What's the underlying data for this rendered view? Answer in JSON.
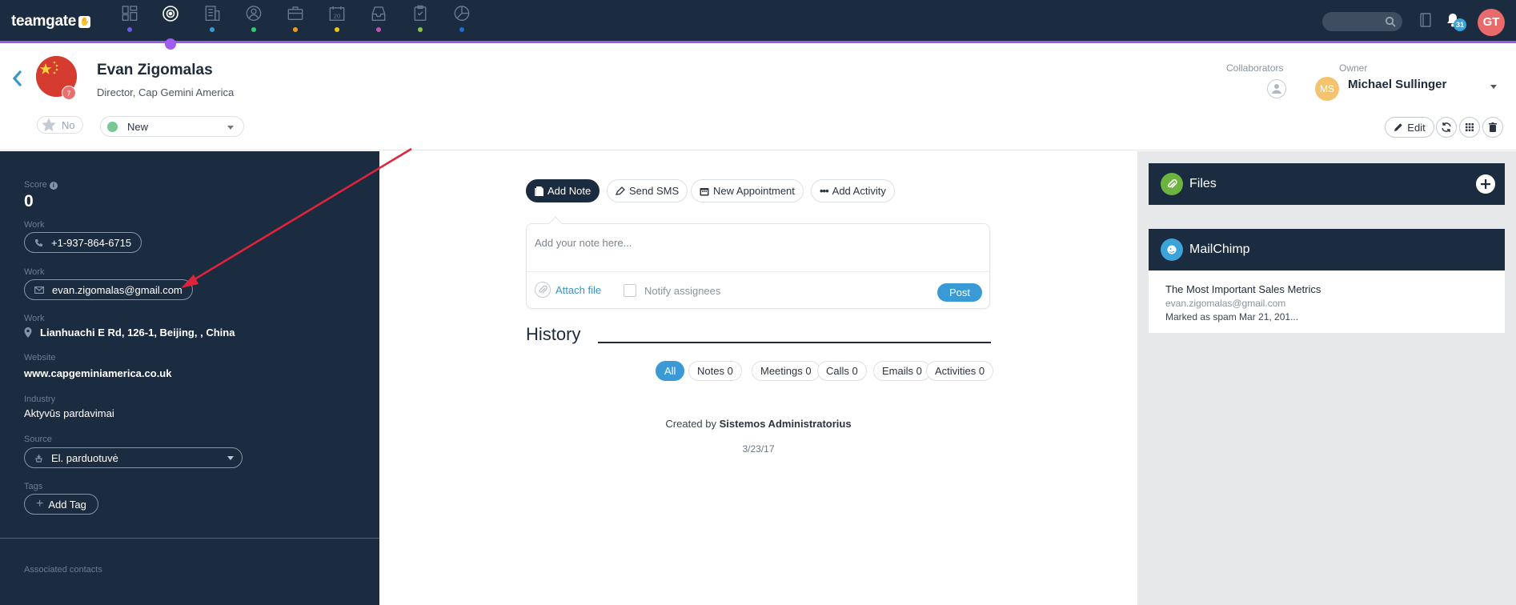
{
  "topnav": {
    "logo": "teamgate",
    "logo_badge_icon": "hand-icon",
    "icons": [
      {
        "name": "dashboard-icon",
        "dot": "#6f59e8"
      },
      {
        "name": "target-icon",
        "dot": "#a25cf2"
      },
      {
        "name": "building-icon",
        "dot": "#3a9ad5"
      },
      {
        "name": "person-icon",
        "dot": "#2ecc71"
      },
      {
        "name": "briefcase-icon",
        "dot": "#f39c12"
      },
      {
        "name": "calendar-icon",
        "dot": "#f1c40f"
      },
      {
        "name": "inbox-icon",
        "dot": "#c44fb8"
      },
      {
        "name": "clipboard-icon",
        "dot": "#8bc34a"
      },
      {
        "name": "chart-icon",
        "dot": "#1e6ed6"
      }
    ],
    "calendar_day": "20",
    "notifications_count": "31",
    "user_initials": "GT"
  },
  "header": {
    "name": "Evan Zigomalas",
    "title": "Director, Cap Gemini America",
    "avatar_count": "7",
    "collaborators_label": "Collaborators",
    "owner_label": "Owner",
    "owner_initials": "MS",
    "owner_name": "Michael Sullinger",
    "favorite_label": "No",
    "status": "New",
    "edit_label": "Edit"
  },
  "left": {
    "score_label": "Score",
    "score_value": "0",
    "phone_label": "Work",
    "phone": "+1-937-864-6715",
    "email_label": "Work",
    "email": "evan.zigomalas@gmail.com",
    "address_label": "Work",
    "address": "Lianhuachi E Rd, 126-1, Beijing, , China",
    "website_label": "Website",
    "website": "www.capgeminiamerica.co.uk",
    "industry_label": "Industry",
    "industry": "Aktyvūs pardavimai",
    "source_label": "Source",
    "source": "El. parduotuvė",
    "tags_label": "Tags",
    "add_tag": "Add Tag",
    "associated_contacts": "Associated contacts"
  },
  "center": {
    "tabs": [
      "Add Note",
      "Send SMS",
      "New Appointment",
      "Add Activity"
    ],
    "note_placeholder": "Add your note here...",
    "attach_file": "Attach file",
    "notify_assignees": "Notify assignees",
    "post": "Post",
    "history_title": "History",
    "filters": [
      "All",
      "Notes 0",
      "Meetings 0",
      "Calls 0",
      "Emails 0",
      "Activities 0"
    ],
    "created_by_prefix": "Created by",
    "created_by_name": "Sistemos Administratorius",
    "created_date": "3/23/17"
  },
  "right": {
    "files_title": "Files",
    "mailchimp_title": "MailChimp",
    "mailchimp_item_title": "The Most Important Sales Metrics",
    "mailchimp_item_email": "evan.zigomalas@gmail.com",
    "mailchimp_item_status": "Marked as spam Mar 21, 201..."
  },
  "colors": {
    "nav_bg": "#1c2c40",
    "accent_purple": "#a25cf2",
    "accent_blue": "#3a9ad5",
    "status_green": "#78c893",
    "annotation_arrow": "#e0223a"
  }
}
